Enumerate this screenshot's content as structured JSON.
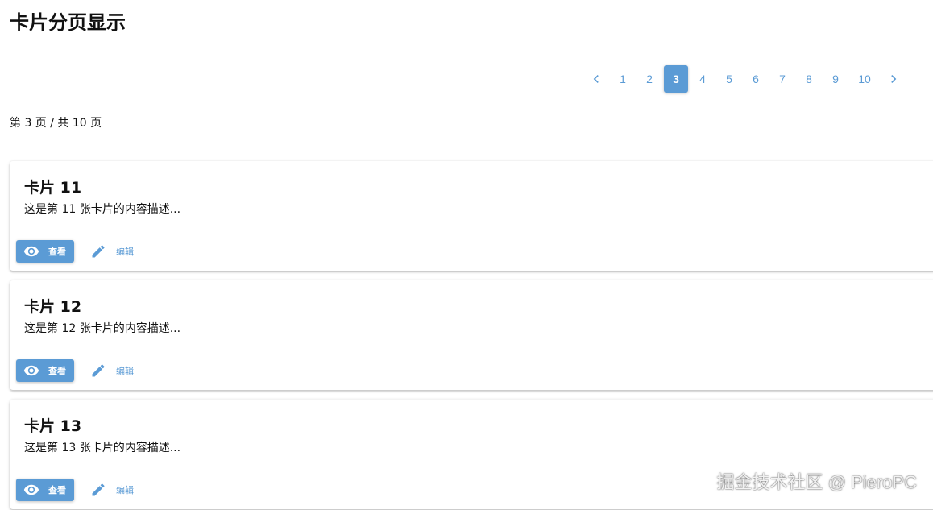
{
  "page": {
    "title": "卡片分页显示",
    "info": "第 3 页 / 共 10 页"
  },
  "pagination": {
    "prev_icon": "chevron-left-icon",
    "next_icon": "chevron-right-icon",
    "pages": [
      "1",
      "2",
      "3",
      "4",
      "5",
      "6",
      "7",
      "8",
      "9",
      "10"
    ],
    "current": "3",
    "accent": "#5b9bd5"
  },
  "cards": [
    {
      "title": "卡片 11",
      "desc": "这是第 11 张卡片的内容描述...",
      "view_label": "查看",
      "edit_label": "编辑"
    },
    {
      "title": "卡片 12",
      "desc": "这是第 12 张卡片的内容描述...",
      "view_label": "查看",
      "edit_label": "编辑"
    },
    {
      "title": "卡片 13",
      "desc": "这是第 13 张卡片的内容描述...",
      "view_label": "查看",
      "edit_label": "编辑"
    }
  ],
  "icons": {
    "view": "eye-icon",
    "edit": "pencil-icon"
  },
  "watermark": "掘金技术社区 @ PieroPC"
}
